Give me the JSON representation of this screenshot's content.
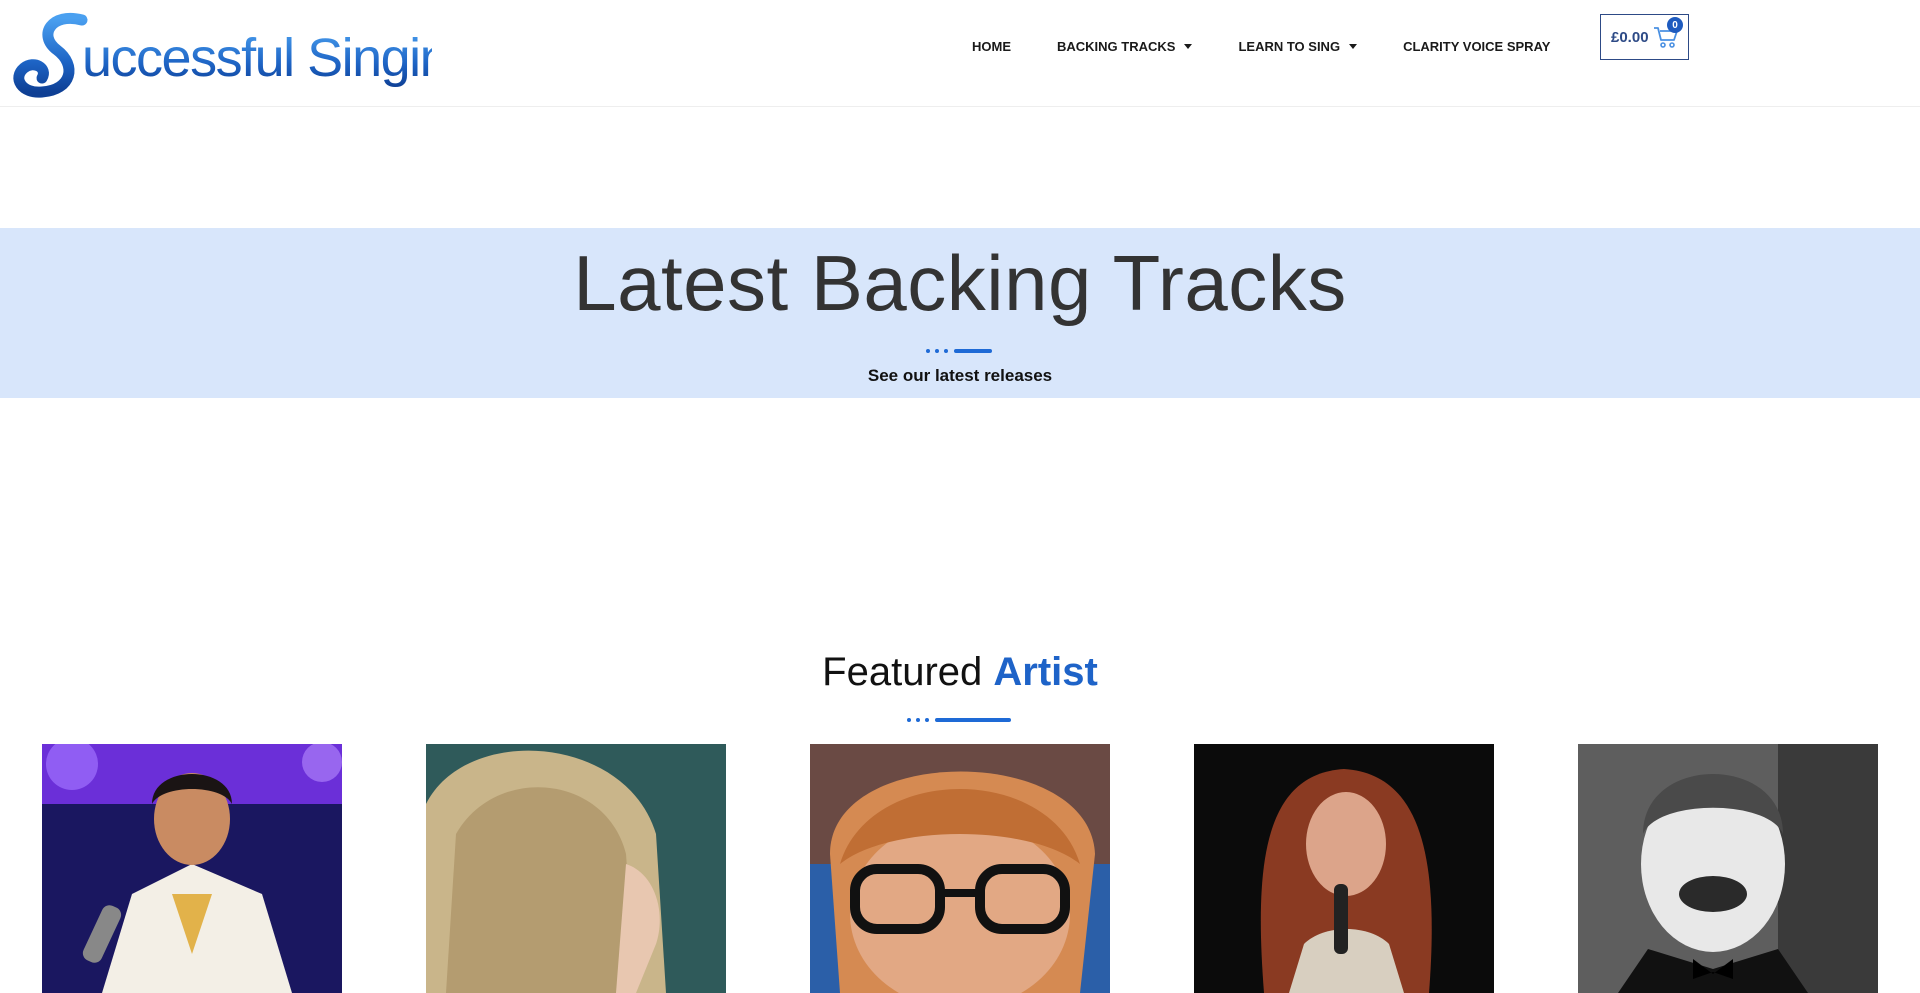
{
  "header": {
    "logo_text": "Successful Singing",
    "nav": [
      {
        "label": "HOME",
        "dropdown": false
      },
      {
        "label": "BACKING TRACKS",
        "dropdown": true
      },
      {
        "label": "LEARN TO SING",
        "dropdown": true
      },
      {
        "label": "CLARITY VOICE SPRAY",
        "dropdown": false
      }
    ],
    "cart": {
      "price": "£0.00",
      "count": "0",
      "icon": "shopping-cart-icon"
    }
  },
  "banner": {
    "title": "Latest Backing Tracks",
    "subtitle": "See our latest releases",
    "background": "#d8e6fb"
  },
  "featured": {
    "title_plain": "Featured",
    "title_accent": "Artist",
    "accent_color": "#1e63c8",
    "artists": [
      {
        "name": "artist-photo-1"
      },
      {
        "name": "artist-photo-2"
      },
      {
        "name": "artist-photo-3"
      },
      {
        "name": "artist-photo-4"
      },
      {
        "name": "artist-photo-5"
      }
    ]
  }
}
